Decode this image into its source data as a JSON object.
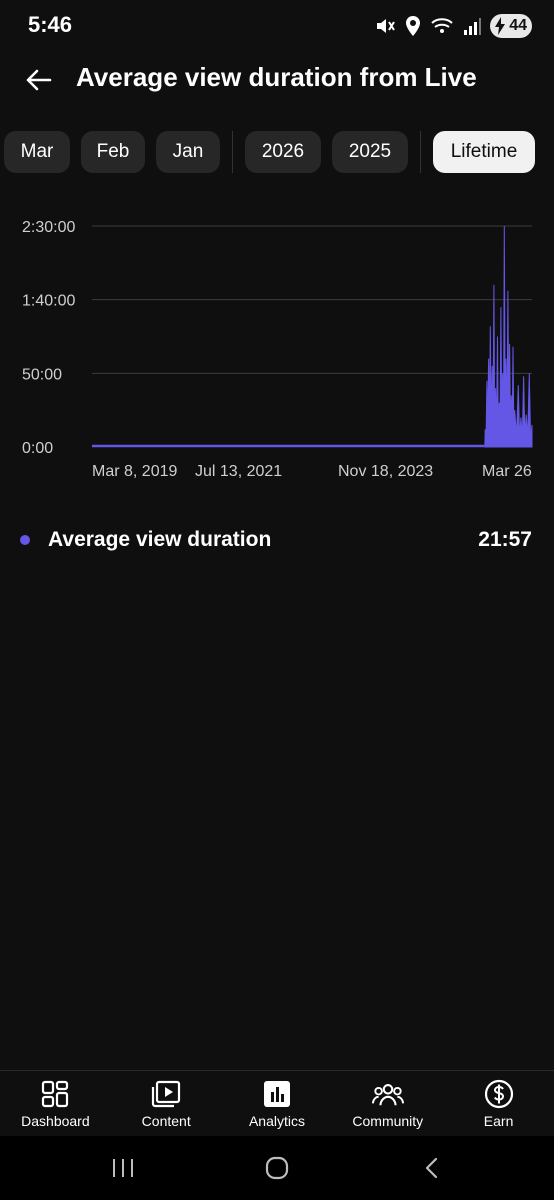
{
  "status_bar": {
    "time": "5:46",
    "battery_level": "44",
    "icons": [
      "mute-vibrate-icon",
      "location-icon",
      "wifi-6-icon",
      "signal-icon",
      "battery-charging-icon"
    ]
  },
  "header": {
    "title": "Average view duration from Live",
    "back_icon": "arrow-left-icon"
  },
  "filters": {
    "chips": [
      {
        "label": "Mar",
        "selected": false
      },
      {
        "label": "Feb",
        "selected": false
      },
      {
        "label": "Jan",
        "selected": false
      },
      {
        "label": "2026",
        "selected": false
      },
      {
        "label": "2025",
        "selected": false
      },
      {
        "label": "Lifetime",
        "selected": true
      }
    ]
  },
  "chart_data": {
    "type": "area",
    "title": "",
    "xlabel": "",
    "ylabel": "",
    "y_tick_labels": [
      "0:00",
      "50:00",
      "1:40:00",
      "2:30:00"
    ],
    "y_tick_minutes": [
      0,
      50,
      100,
      150
    ],
    "ylim_minutes": [
      0,
      150
    ],
    "x_tick_labels": [
      "Mar 8, 2019",
      "Jul 13, 2021",
      "Nov 18, 2023",
      "Mar 26"
    ],
    "grid": true,
    "color": "#6457e6",
    "series": [
      {
        "name": "Average view duration",
        "baseline_minutes": 0,
        "spike_dates": [
          "2025-07",
          "2025-08",
          "2025-09",
          "2025-10",
          "2025-11",
          "2025-12",
          "2026-01",
          "2026-02",
          "2026-03"
        ],
        "points": [
          {
            "x": "2025-06-20",
            "y": 0
          },
          {
            "x": "2025-06-25",
            "y": 12
          },
          {
            "x": "2025-07-05",
            "y": 45
          },
          {
            "x": "2025-07-15",
            "y": 60
          },
          {
            "x": "2025-07-25",
            "y": 82
          },
          {
            "x": "2025-08-05",
            "y": 55
          },
          {
            "x": "2025-08-15",
            "y": 110
          },
          {
            "x": "2025-08-25",
            "y": 40
          },
          {
            "x": "2025-09-05",
            "y": 75
          },
          {
            "x": "2025-09-15",
            "y": 30
          },
          {
            "x": "2025-09-25",
            "y": 95
          },
          {
            "x": "2025-10-05",
            "y": 50
          },
          {
            "x": "2025-10-15",
            "y": 150
          },
          {
            "x": "2025-10-25",
            "y": 60
          },
          {
            "x": "2025-11-05",
            "y": 106
          },
          {
            "x": "2025-11-15",
            "y": 70
          },
          {
            "x": "2025-11-25",
            "y": 35
          },
          {
            "x": "2025-12-05",
            "y": 68
          },
          {
            "x": "2025-12-15",
            "y": 25
          },
          {
            "x": "2026-01-05",
            "y": 42
          },
          {
            "x": "2026-01-20",
            "y": 20
          },
          {
            "x": "2026-02-05",
            "y": 48
          },
          {
            "x": "2026-02-20",
            "y": 22
          },
          {
            "x": "2026-03-10",
            "y": 50
          },
          {
            "x": "2026-03-26",
            "y": 15
          }
        ]
      }
    ]
  },
  "legend": {
    "label": "Average view duration",
    "value": "21:57",
    "dot_color": "#6457e6"
  },
  "bottom_nav": {
    "items": [
      {
        "label": "Dashboard",
        "icon": "dashboard-icon"
      },
      {
        "label": "Content",
        "icon": "content-icon"
      },
      {
        "label": "Analytics",
        "icon": "analytics-icon",
        "active": true
      },
      {
        "label": "Community",
        "icon": "community-icon"
      },
      {
        "label": "Earn",
        "icon": "earn-icon"
      }
    ]
  },
  "system_nav": {
    "buttons": [
      "recent-apps-icon",
      "home-icon",
      "back-icon"
    ]
  }
}
